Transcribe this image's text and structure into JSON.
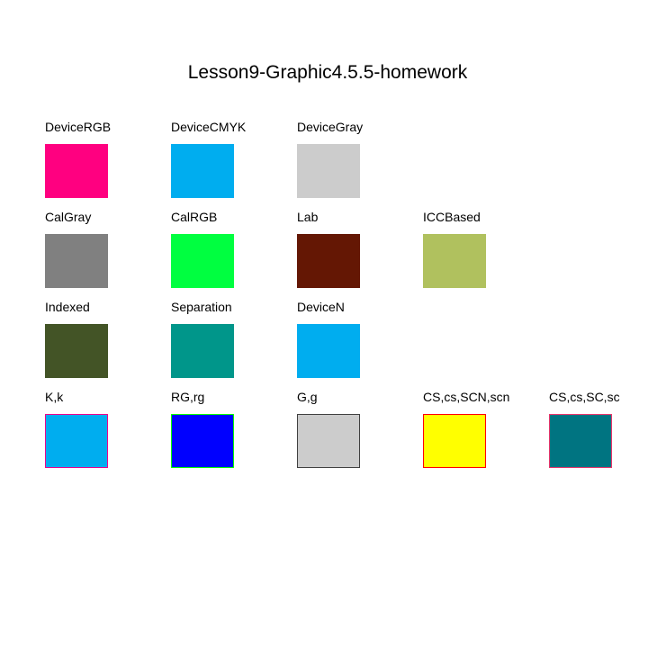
{
  "title": "Lesson9-Graphic4.5.5-homework",
  "rows": [
    [
      {
        "label": "DeviceRGB",
        "fill": "#ff0080"
      },
      {
        "label": "DeviceCMYK",
        "fill": "#00adef"
      },
      {
        "label": "DeviceGray",
        "fill": "#cccccc"
      }
    ],
    [
      {
        "label": "CalGray",
        "fill": "#808080"
      },
      {
        "label": "CalRGB",
        "fill": "#00ff40"
      },
      {
        "label": "Lab",
        "fill": "#641704"
      },
      {
        "label": "ICCBased",
        "fill": "#b0c15e"
      }
    ],
    [
      {
        "label": "Indexed",
        "fill": "#435426"
      },
      {
        "label": "Separation",
        "fill": "#00968a"
      },
      {
        "label": "DeviceN",
        "fill": "#00adef"
      }
    ],
    [
      {
        "label": "K,k",
        "fill": "#00adef",
        "stroke": "#ec008c"
      },
      {
        "label": "RG,rg",
        "fill": "#0000ff",
        "stroke": "#00ff00"
      },
      {
        "label": "G,g",
        "fill": "#cccccc",
        "stroke": "#404040"
      },
      {
        "label": "CS,cs,SCN,scn",
        "fill": "#ffff00",
        "stroke": "#ff0000"
      },
      {
        "label": "CS,cs,SC,sc",
        "fill": "#007481",
        "stroke": "#e8346a"
      }
    ]
  ]
}
